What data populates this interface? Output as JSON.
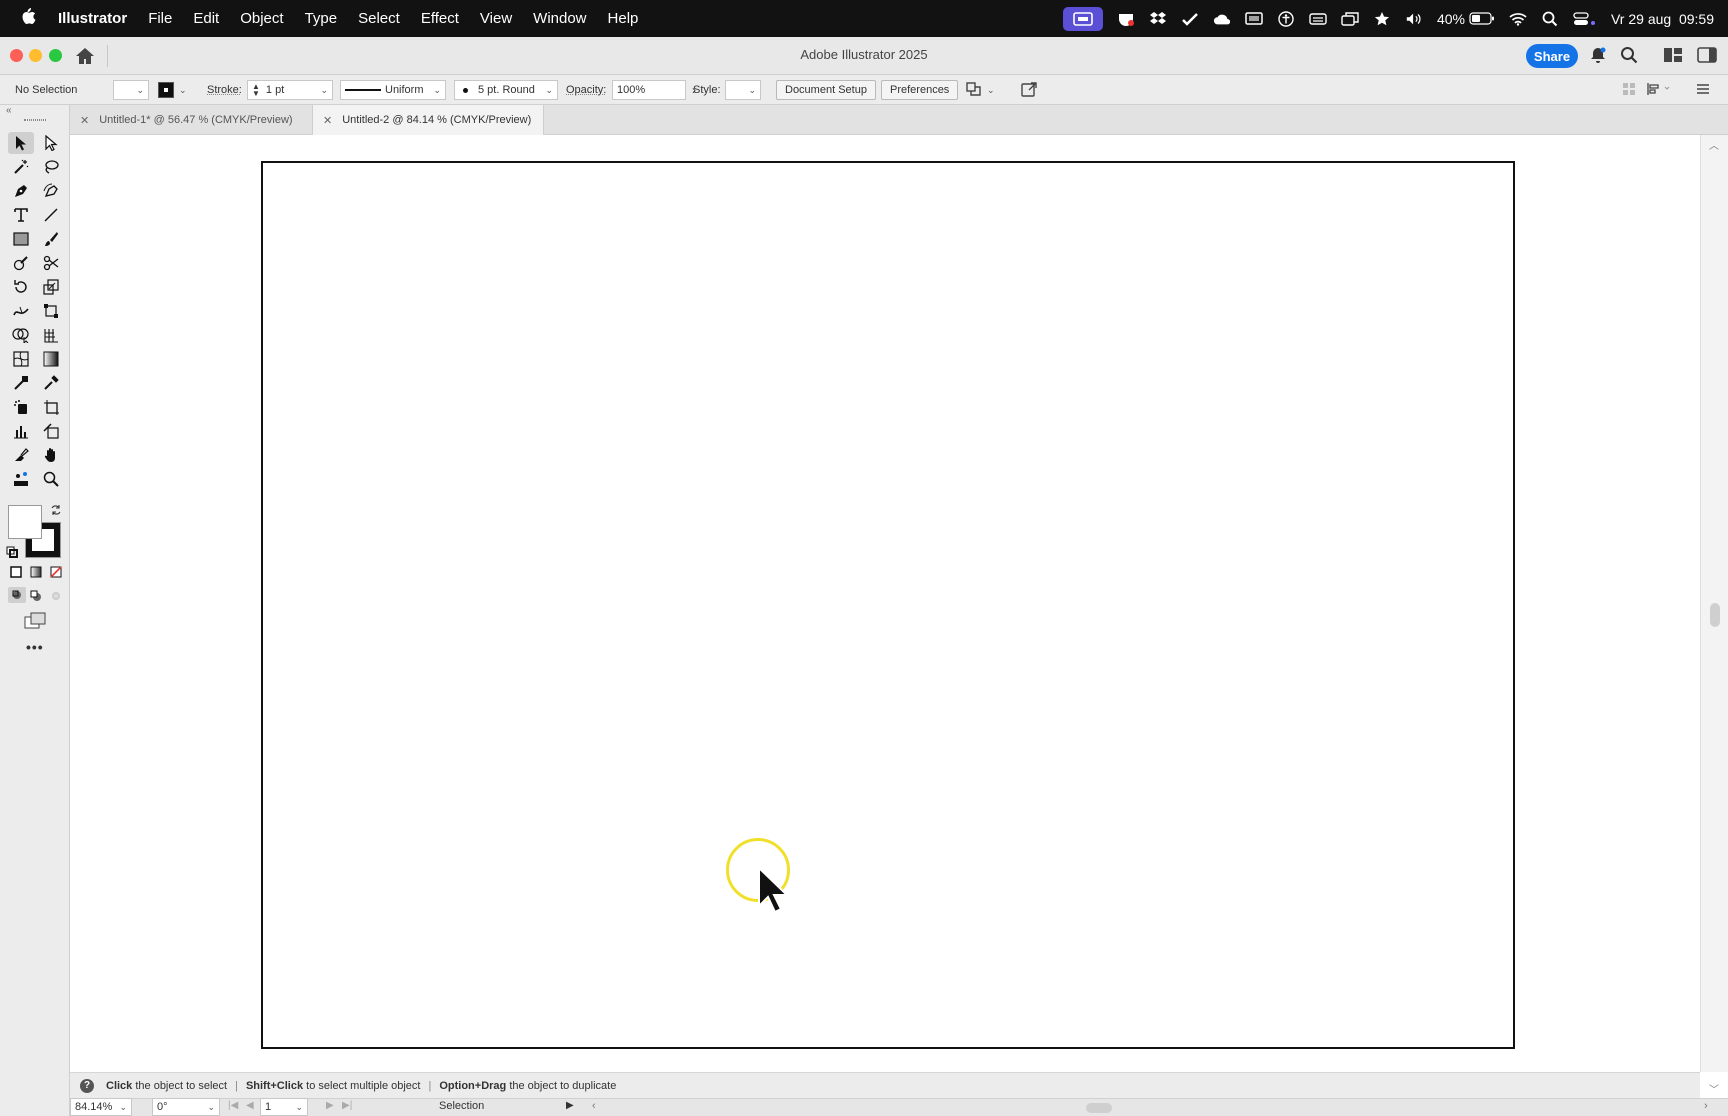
{
  "menubar": {
    "app_name": "Illustrator",
    "items": [
      "File",
      "Edit",
      "Object",
      "Type",
      "Select",
      "Effect",
      "View",
      "Window",
      "Help"
    ],
    "battery": "40%",
    "datetime": "Vr 29 aug  09:59"
  },
  "window": {
    "title": "Adobe Illustrator 2025",
    "share_label": "Share"
  },
  "control": {
    "selection_label": "No Selection",
    "stroke_label": "Stroke:",
    "stroke_value": "1 pt",
    "profile_label": "Uniform",
    "brush_label": "5 pt. Round",
    "opacity_label": "Opacity:",
    "opacity_value": "100%",
    "style_label": "Style:",
    "document_setup_label": "Document Setup",
    "preferences_label": "Preferences"
  },
  "tabs": [
    {
      "label": "Untitled-1* @ 56.47 % (CMYK/Preview)",
      "active": false
    },
    {
      "label": "Untitled-2 @ 84.14 % (CMYK/Preview)",
      "active": true
    }
  ],
  "statushelp": {
    "part1_bold": "Click",
    "part1": " the object to select",
    "part2_bold": "Shift+Click",
    "part2": " to select multiple object",
    "part3_bold": "Option+Drag",
    "part3": " the object to duplicate"
  },
  "statusbar": {
    "zoom": "84.14%",
    "rotation": "0°",
    "artboard_num": "1",
    "tool_name": "Selection"
  },
  "colors": {
    "menubar_bg": "#121212",
    "accent": "#1473e6",
    "recording_badge": "#5b4fd6",
    "cursor_ring": "#f0e02c"
  }
}
